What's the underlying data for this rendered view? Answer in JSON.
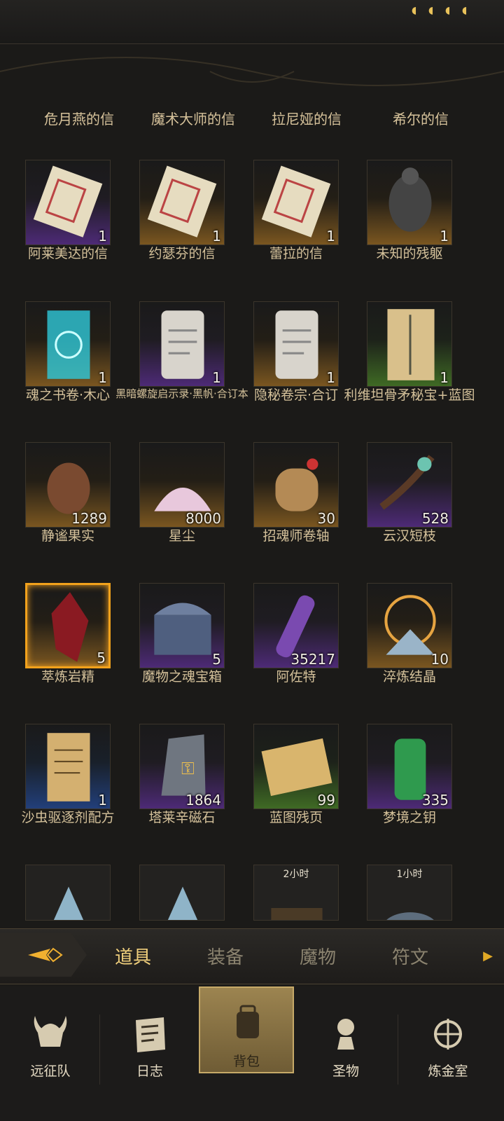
{
  "header_letters": [
    "危月燕的信",
    "魔术大师的信",
    "拉尼娅的信",
    "希尔的信"
  ],
  "items": [
    {
      "name": "阿莱美达的信",
      "count": "1",
      "rarity": "purple",
      "icon": "letter-icon"
    },
    {
      "name": "约瑟芬的信",
      "count": "1",
      "rarity": "orange",
      "icon": "letter-icon"
    },
    {
      "name": "蕾拉的信",
      "count": "1",
      "rarity": "orange",
      "icon": "letter-icon"
    },
    {
      "name": "未知的残躯",
      "count": "1",
      "rarity": "orange",
      "icon": "corpse-icon"
    },
    {
      "name": "魂之书卷·木心",
      "count": "1",
      "rarity": "orange",
      "icon": "glowing-scroll-icon"
    },
    {
      "name": "黑暗螺旋启示录·黑帆·合订本",
      "count": "1",
      "rarity": "purple",
      "icon": "scroll-icon"
    },
    {
      "name": "隐秘卷宗·合订",
      "count": "1",
      "rarity": "orange",
      "icon": "scroll-icon"
    },
    {
      "name": "利维坦骨矛秘宝+蓝图",
      "count": "1",
      "rarity": "green",
      "icon": "blueprint-scroll-icon"
    },
    {
      "name": "静谧果实",
      "count": "1289",
      "rarity": "orange",
      "icon": "pinecone-icon"
    },
    {
      "name": "星尘",
      "count": "8000",
      "rarity": "orange",
      "icon": "stardust-icon"
    },
    {
      "name": "招魂师卷轴",
      "count": "30",
      "rarity": "orange",
      "icon": "rolled-scroll-icon"
    },
    {
      "name": "云汉短枝",
      "count": "528",
      "rarity": "purple",
      "icon": "branch-icon"
    },
    {
      "name": "萃炼岩精",
      "count": "5",
      "rarity": "gold",
      "icon": "red-crystal-icon"
    },
    {
      "name": "魔物之魂宝箱",
      "count": "5",
      "rarity": "purple",
      "icon": "chest-icon"
    },
    {
      "name": "阿佐特",
      "count": "35217",
      "rarity": "purple",
      "icon": "potion-vial-icon"
    },
    {
      "name": "淬炼结晶",
      "count": "10",
      "rarity": "orange",
      "icon": "crystal-icon"
    },
    {
      "name": "沙虫驱逐剂配方",
      "count": "1",
      "rarity": "blue",
      "icon": "recipe-scroll-icon"
    },
    {
      "name": "塔莱辛磁石",
      "count": "1864",
      "rarity": "purple",
      "icon": "magnet-stone-icon"
    },
    {
      "name": "蓝图残页",
      "count": "99",
      "rarity": "green",
      "icon": "blueprint-page-icon"
    },
    {
      "name": "梦境之钥",
      "count": "335",
      "rarity": "purple",
      "icon": "green-lantern-icon"
    }
  ],
  "partial_items": [
    {
      "timer": "",
      "icon": "ice-crystal-icon"
    },
    {
      "timer": "",
      "icon": "ice-crystal-icon"
    },
    {
      "timer": "2小时",
      "icon": "cart-icon"
    },
    {
      "timer": "1小时",
      "icon": "helmet-icon"
    }
  ],
  "tabs": [
    {
      "label": "道具",
      "active": true
    },
    {
      "label": "装备"
    },
    {
      "label": "魔物"
    },
    {
      "label": "符文"
    }
  ],
  "nav": [
    {
      "label": "远征队",
      "icon": "viking-helmet-icon"
    },
    {
      "label": "日志",
      "icon": "journal-icon"
    },
    {
      "label": "背包",
      "icon": "backpack-icon",
      "active": true
    },
    {
      "label": "圣物",
      "icon": "relic-icon"
    },
    {
      "label": "炼金室",
      "icon": "alchemy-icon"
    }
  ],
  "colors": {
    "accent": "#f0cf7c",
    "purple_rarity": "#4d2a76",
    "orange_rarity": "#7a5620",
    "green_rarity": "#3f6a24",
    "blue_rarity": "#223f7a",
    "gold_border": "#f2a21c"
  }
}
